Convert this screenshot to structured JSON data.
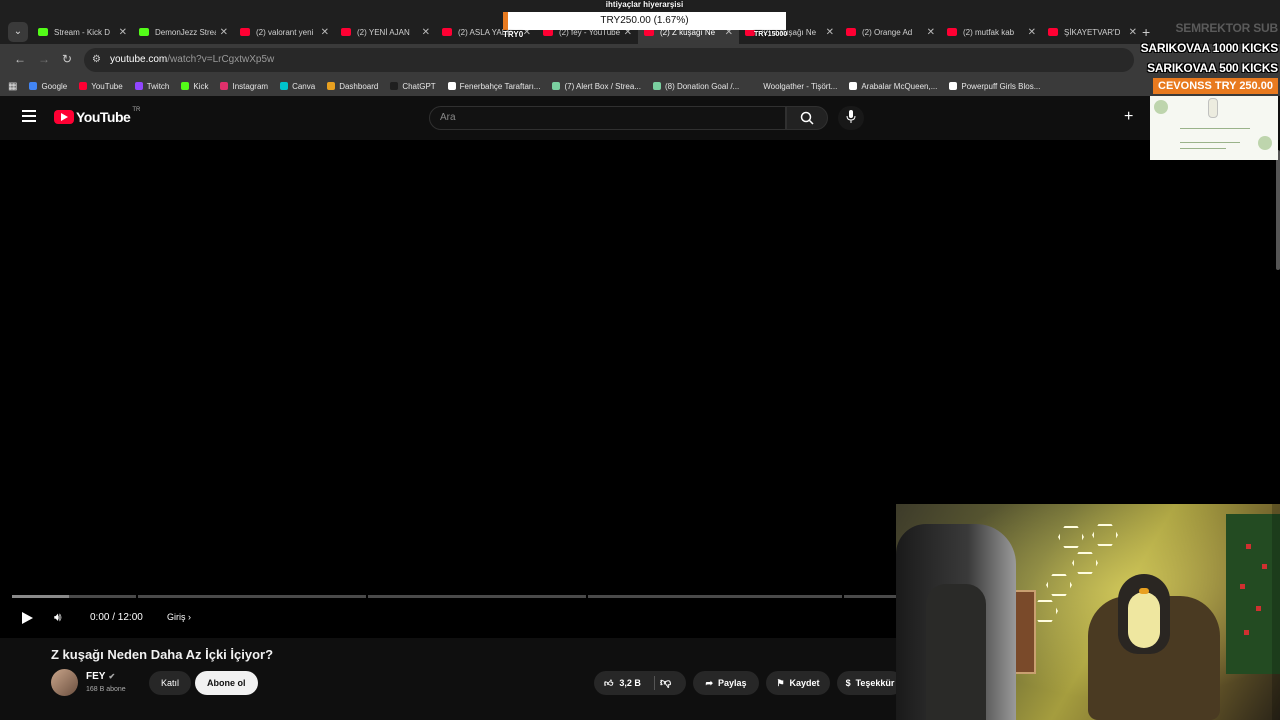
{
  "browser": {
    "tabs": [
      {
        "label": "Stream - Kick D",
        "icon": "kick",
        "active": false
      },
      {
        "label": "DemonJezz Stream",
        "icon": "kick",
        "active": false
      },
      {
        "label": "(2) valorant yeni",
        "icon": "youtube",
        "active": false
      },
      {
        "label": "(2) YENİ AJAN",
        "icon": "youtube",
        "active": false
      },
      {
        "label": "(2) ASLA YALN",
        "icon": "youtube",
        "active": false
      },
      {
        "label": "(2) fey - YouTube",
        "icon": "youtube",
        "active": false
      },
      {
        "label": "(2) Z kuşağı Ne",
        "icon": "youtube",
        "active": true
      },
      {
        "label": "(2) Z kuşağı Ne",
        "icon": "youtube",
        "active": false
      },
      {
        "label": "(2) Orange Ad",
        "icon": "youtube",
        "active": false
      },
      {
        "label": "(2) mutfak kab",
        "icon": "youtube",
        "active": false
      },
      {
        "label": "ŞİKAYETVAR'D",
        "icon": "youtube",
        "active": false
      }
    ],
    "url_domain": "youtube.com",
    "url_path": "/watch?v=LrCgxtwXp5w",
    "bookmarks": [
      {
        "label": "Google",
        "color": "#4285f4"
      },
      {
        "label": "YouTube",
        "color": "#ff0033"
      },
      {
        "label": "Twitch",
        "color": "#9146ff"
      },
      {
        "label": "Kick",
        "color": "#53fc18"
      },
      {
        "label": "Instagram",
        "color": "#e1306c"
      },
      {
        "label": "Canva",
        "color": "#00c4cc"
      },
      {
        "label": "Dashboard",
        "color": "#e8a020"
      },
      {
        "label": "ChatGPT",
        "color": "#1f1f1f"
      },
      {
        "label": "Fenerbahçe Taraftarı...",
        "color": "#ffffff"
      },
      {
        "label": "(7) Alert Box / Strea...",
        "color": "#7ad0a0"
      },
      {
        "label": "(8) Donation Goal /...",
        "color": "#7ad0a0"
      },
      {
        "label": "Woolgather - Tişört...",
        "color": "#3a3a3a"
      },
      {
        "label": "Arabalar McQueen,...",
        "color": "#ffffff"
      },
      {
        "label": "Powerpuff Girls Blos...",
        "color": "#ffffff"
      }
    ]
  },
  "youtube": {
    "logo_text": "YouTube",
    "country": "TR",
    "search_placeholder": "Ara",
    "create_label": "+"
  },
  "player": {
    "time": "0:00 / 12:00",
    "chapter": "Giriş",
    "loaded_fraction": 0.036
  },
  "video": {
    "title": "Z kuşağı Neden Daha Az İçki İçiyor?",
    "channel": "FEY",
    "subscribers": "168 B abone",
    "join_label": "Katıl",
    "subscribe_label": "Abone ol",
    "likes": "3,2 B",
    "share_label": "Paylaş",
    "save_label": "Kaydet",
    "thanks_label": "Teşekkür"
  },
  "overlay": {
    "goal_title": "ihtiyaçlar hiyerarşisi",
    "goal_amount": "TRY250.00 (1.67%)",
    "goal_fraction": 0.0167,
    "goal_start": "TRY0",
    "goal_end": "TRY15000",
    "alerts": [
      {
        "text": "SEMREKTOR SUB",
        "faint": true
      },
      {
        "text": "SARIKOVAA 1000 KICKS",
        "faint": false
      },
      {
        "text": "SARIKOVAA 500 KICKS",
        "faint": false
      }
    ],
    "highlight": "CEVONSS TRY 250.00",
    "accent": "#e87a1f"
  }
}
